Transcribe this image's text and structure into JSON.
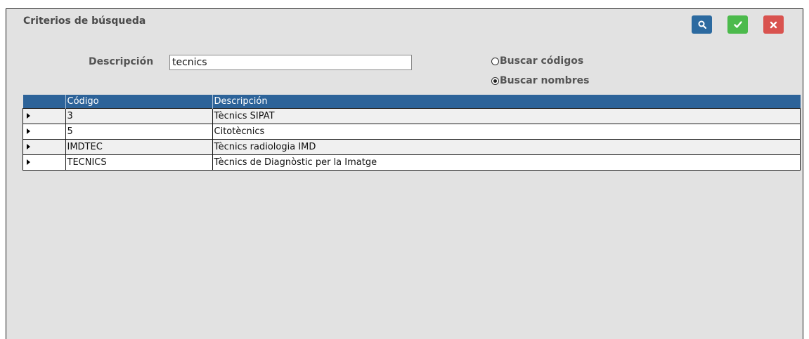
{
  "header": {
    "title": "Criterios de búsqueda"
  },
  "toolbar": {
    "search_icon": "search-icon",
    "ok_icon": "check-icon",
    "cancel_icon": "close-icon",
    "colors": {
      "search": "#2c6aa0",
      "ok": "#4cba4c",
      "cancel": "#d9534f"
    }
  },
  "form": {
    "description_label": "Descripción",
    "description_value": "tecnics",
    "radio_codes_label": "Buscar códigos",
    "radio_names_label": "Buscar nombres",
    "selected_option": "Buscar nombres"
  },
  "grid": {
    "columns": [
      "",
      "Código",
      "Descripción"
    ],
    "rows": [
      {
        "code": "3",
        "description": "Tècnics SIPAT"
      },
      {
        "code": "5",
        "description": "Citotècnics"
      },
      {
        "code": "IMDTEC",
        "description": "Tècnics radiologia IMD"
      },
      {
        "code": "TECNICS",
        "description": "Tècnics de Diagnòstic per la Imatge"
      }
    ]
  }
}
